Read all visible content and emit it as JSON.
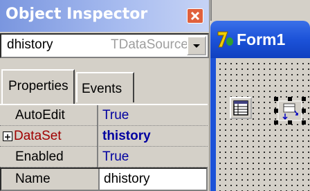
{
  "inspector": {
    "title": "Object Inspector",
    "component_name": "dhistory",
    "component_type": "TDataSource",
    "tabs": [
      "Properties",
      "Events"
    ],
    "properties": [
      {
        "name": "AutoEdit",
        "value": "True"
      },
      {
        "name": "DataSet",
        "value": "thistory",
        "expandable": true
      },
      {
        "name": "Enabled",
        "value": "True"
      },
      {
        "name": "Name",
        "value": "dhistory",
        "selected": true
      }
    ]
  },
  "form": {
    "title": "Form1"
  },
  "colors": {
    "inspector_title_gradient": "#7a96df",
    "form_title": "#1c52d8",
    "property_value": "#0000a0",
    "dataset_name": "#a00000",
    "close_button": "#e0603c"
  }
}
